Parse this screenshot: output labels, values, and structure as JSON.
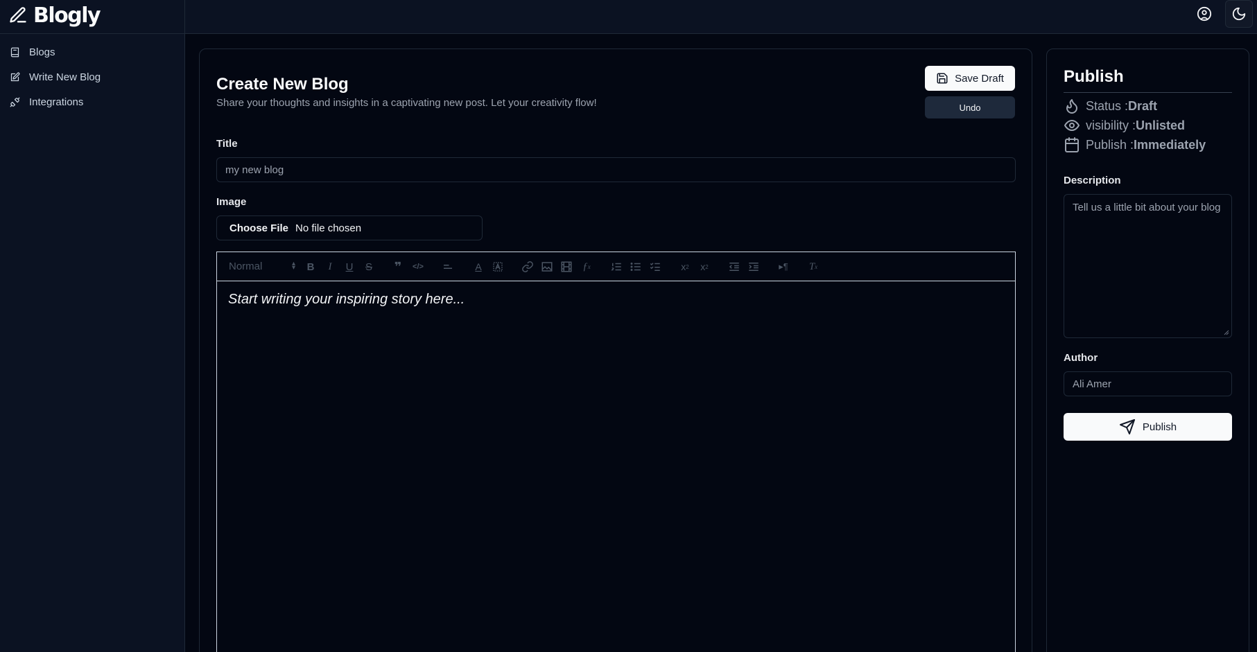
{
  "app": {
    "name": "Blogly"
  },
  "sidebar": {
    "items": [
      {
        "label": "Blogs",
        "icon": "book-icon"
      },
      {
        "label": "Write New Blog",
        "icon": "edit-icon"
      },
      {
        "label": "Integrations",
        "icon": "plug-icon"
      }
    ]
  },
  "page": {
    "title": "Create New Blog",
    "subtitle": "Share your thoughts and insights in a captivating new post. Let your creativity flow!",
    "save_draft_label": "Save Draft",
    "undo_label": "Undo"
  },
  "form": {
    "title_label": "Title",
    "title_placeholder": "my new blog",
    "image_label": "Image",
    "file_button": "Choose File",
    "file_status": "No file chosen"
  },
  "editor": {
    "heading_select": "Normal",
    "placeholder": "Start writing your inspiring story here..."
  },
  "publish": {
    "title": "Publish",
    "status_label": "Status : ",
    "status_value": "Draft",
    "visibility_label": "visibility : ",
    "visibility_value": "Unlisted",
    "publish_label": "Publish : ",
    "publish_value": "Immediately",
    "description_label": "Description",
    "description_placeholder": "Tell us a little bit about your blog",
    "author_label": "Author",
    "author_placeholder": "Ali Amer",
    "publish_button": "Publish"
  },
  "colors": {
    "background": "#030712",
    "panel": "#0b1222",
    "border": "#1f2937",
    "primary_button": "#f9fafb",
    "secondary_button": "#1e293b"
  }
}
